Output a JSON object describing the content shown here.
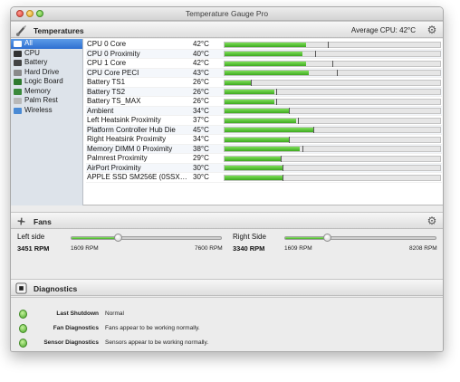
{
  "window": {
    "title": "Temperature Gauge Pro"
  },
  "temperatures": {
    "section_title": "Temperatures",
    "average_label": "Average CPU:",
    "average_value": "42°C",
    "sidebar": [
      {
        "label": "All",
        "icon": "all-icon",
        "color": "#3b6fb0"
      },
      {
        "label": "CPU",
        "icon": "cpu-icon",
        "color": "#333333"
      },
      {
        "label": "Battery",
        "icon": "battery-icon",
        "color": "#444444"
      },
      {
        "label": "Hard Drive",
        "icon": "hard-drive-icon",
        "color": "#8a8a8a"
      },
      {
        "label": "Logic Board",
        "icon": "logic-board-icon",
        "color": "#2f7a2f"
      },
      {
        "label": "Memory",
        "icon": "memory-icon",
        "color": "#3c8a3c"
      },
      {
        "label": "Palm Rest",
        "icon": "palm-rest-icon",
        "color": "#b8b8b8"
      },
      {
        "label": "Wireless",
        "icon": "wireless-icon",
        "color": "#4a8ad4"
      }
    ],
    "sensors": [
      {
        "name": "CPU 0 Core",
        "value": "42°C",
        "level": 0.38,
        "marker": 0.48
      },
      {
        "name": "CPU 0 Proximity",
        "value": "40°C",
        "level": 0.36,
        "marker": 0.42
      },
      {
        "name": "CPU 1 Core",
        "value": "42°C",
        "level": 0.38,
        "marker": 0.5
      },
      {
        "name": "CPU Core PECI",
        "value": "43°C",
        "level": 0.39,
        "marker": 0.52
      },
      {
        "name": "Battery TS1",
        "value": "26°C",
        "level": 0.12,
        "marker": 0.12
      },
      {
        "name": "Battery TS2",
        "value": "26°C",
        "level": 0.23,
        "marker": 0.24
      },
      {
        "name": "Battery TS_MAX",
        "value": "26°C",
        "level": 0.23,
        "marker": 0.24
      },
      {
        "name": "Ambient",
        "value": "34°C",
        "level": 0.3,
        "marker": 0.3
      },
      {
        "name": "Left Heatsink Proximity",
        "value": "37°C",
        "level": 0.33,
        "marker": 0.34
      },
      {
        "name": "Platform Controller Hub Die",
        "value": "45°C",
        "level": 0.41,
        "marker": 0.41
      },
      {
        "name": "Right Heatsink Proximity",
        "value": "34°C",
        "level": 0.3,
        "marker": 0.3
      },
      {
        "name": "Memory DIMM 0 Proximity",
        "value": "38°C",
        "level": 0.35,
        "marker": 0.36
      },
      {
        "name": "Palmrest Proximity",
        "value": "29°C",
        "level": 0.26,
        "marker": 0.26
      },
      {
        "name": "AirPort Proximity",
        "value": "30°C",
        "level": 0.27,
        "marker": 0.27
      },
      {
        "name": "APPLE SSD SM256E (0SSXYN...",
        "value": "30°C",
        "level": 0.27,
        "marker": 0.27
      }
    ]
  },
  "fans": {
    "section_title": "Fans",
    "items": [
      {
        "label": "Left side",
        "rpm": "3451 RPM",
        "min": "1609 RPM",
        "max": "7600 RPM",
        "level": 0.31
      },
      {
        "label": "Right Side",
        "rpm": "3340 RPM",
        "min": "1609 RPM",
        "max": "8208 RPM",
        "level": 0.28
      }
    ]
  },
  "diagnostics": {
    "section_title": "Diagnostics",
    "items": [
      {
        "key": "Last Shutdown",
        "value": "Normal"
      },
      {
        "key": "Fan Diagnostics",
        "value": "Fans appear to be working normally."
      },
      {
        "key": "Sensor Diagnostics",
        "value": "Sensors appear to be working normally."
      }
    ]
  }
}
